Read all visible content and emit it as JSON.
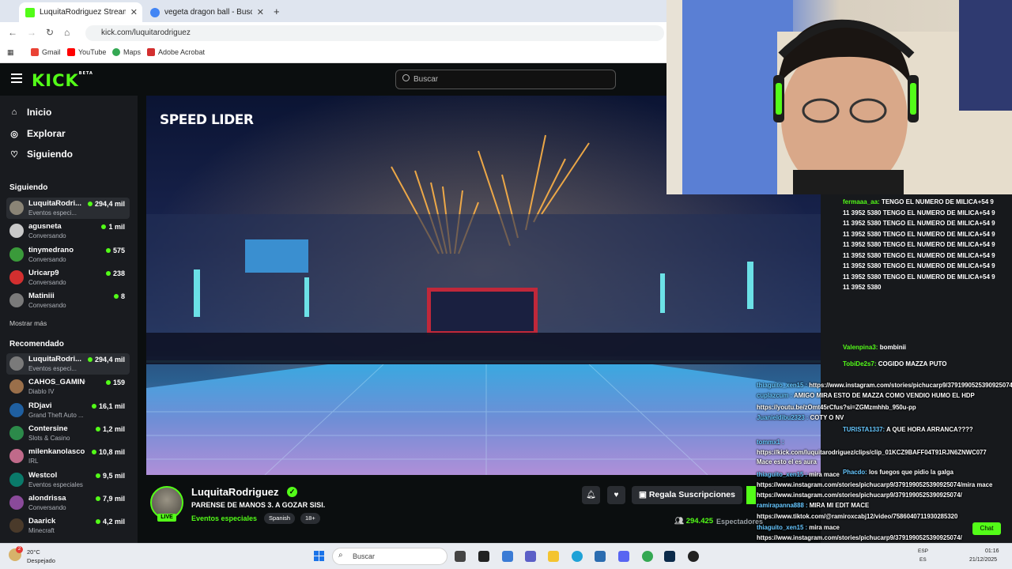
{
  "browser": {
    "tabs": [
      {
        "title": "LuquitaRodriguez Stream"
      },
      {
        "title": "vegeta dragon ball - Buscar con"
      }
    ],
    "url": "kick.com/luquitarodriguez",
    "bookmarks": [
      "Gmail",
      "YouTube",
      "Maps",
      "Adobe Acrobat"
    ]
  },
  "kick": {
    "logo": "KICK",
    "logo_sup": "BETA",
    "search_placeholder": "Buscar"
  },
  "sidebar": {
    "nav": [
      {
        "label": "Inicio",
        "icon": "home-icon"
      },
      {
        "label": "Explorar",
        "icon": "compass-icon"
      },
      {
        "label": "Siguiendo",
        "icon": "heart-icon"
      }
    ],
    "following_header": "Siguiendo",
    "following": [
      {
        "name": "LuquitaRodri...",
        "category": "Eventos especi...",
        "viewers": "294,4 mil"
      },
      {
        "name": "agusneta",
        "category": "Conversando",
        "viewers": "1 mil"
      },
      {
        "name": "tinymedrano",
        "category": "Conversando",
        "viewers": "575"
      },
      {
        "name": "Uricarp9",
        "category": "Conversando",
        "viewers": "238"
      },
      {
        "name": "Matiniii",
        "category": "Conversando",
        "viewers": "8"
      }
    ],
    "show_more": "Mostrar más",
    "recommended_header": "Recomendado",
    "recommended": [
      {
        "name": "LuquitaRodri...",
        "category": "Eventos especi...",
        "viewers": "294,4 mil"
      },
      {
        "name": "CAHOS_GAMING",
        "category": "Diablo IV",
        "viewers": "159"
      },
      {
        "name": "RDjavi",
        "category": "Grand Theft Auto ...",
        "viewers": "16,1 mil"
      },
      {
        "name": "Contersine",
        "category": "Slots & Casino",
        "viewers": "1,2 mil"
      },
      {
        "name": "milenkanolasco",
        "category": "IRL",
        "viewers": "10,8 mil"
      },
      {
        "name": "Westcol",
        "category": "Eventos especiales",
        "viewers": "9,5 mil"
      },
      {
        "name": "alondrissa",
        "category": "Conversando",
        "viewers": "7,9 mil"
      },
      {
        "name": "Daarick",
        "category": "Minecraft",
        "viewers": "4,2 mil"
      }
    ]
  },
  "video": {
    "overlay_logo": "SPEED LIDER"
  },
  "stream": {
    "streamer": "LuquitaRodriguez",
    "live_badge": "LIVE",
    "title": "PARENSE DE MANOS 3. A GOZAR SISI.",
    "category": "Eventos especiales",
    "tags": [
      "Spanish",
      "18+"
    ],
    "gift_label": "Regala Suscripciones",
    "viewers": "294.425",
    "viewers_label": "Espectadores"
  },
  "chat": {
    "messages": [
      {
        "user": "fermaaa_aa:",
        "text": "TENGO EL NUMERO DE MILICA+54 9 11 3952 5380 TENGO EL NUMERO DE MILICA+54 9 11 3952 5380 TENGO EL NUMERO DE MILICA+54 9 11 3952 5380 TENGO EL NUMERO DE MILICA+54 9 11 3952 5380 TENGO EL NUMERO DE MILICA+54 9 11 3952 5380 TENGO EL NUMERO DE MILICA+54 9 11 3952 5380 TENGO EL NUMERO DE MILICA+54 9 11 3952 5380 TENGO EL NUMERO DE MILICA+54 9 11 3952 5380"
      },
      {
        "user": "Valenpina3:",
        "text": "bombinii"
      },
      {
        "user": "TobiDe2s7:",
        "text": "COGIDO MAZZA PUTO"
      }
    ],
    "overlay": [
      {
        "user": "thiaguito_xen15 :",
        "text": "https://www.instagram.com/stories/pichucarp9/3791990525390925074/"
      },
      {
        "user": "cuplazcum :",
        "text": "AMIGO MIRA ESTO DE MAZZA COMO VENDIO HUMO EL HDP"
      },
      {
        "user": "",
        "text": "https://youtu.be/zOmt45rCfus?si=ZGMzmhhb_950u-pp"
      },
      {
        "user": "Juanieldibu2323 :",
        "text": "COTY O NV"
      },
      {
        "user": "TURISTA1337:",
        "text": "A QUE HORA ARRANCA????"
      },
      {
        "user": "tommx1 :",
        "text": ""
      },
      {
        "user": "",
        "text": "https://kick.com/luquitarodriguez/clips/clip_01KCZ9BAFF04T91RJN6ZNWC077"
      },
      {
        "user": "",
        "text": "Mace esto el es aura"
      },
      {
        "user": "Phacdo:",
        "text": "los fuegos que pidio la galga"
      },
      {
        "user": "thiaguito_xen15 :",
        "text": "mira mace"
      },
      {
        "user": "",
        "text": "https://www.instagram.com/stories/pichucarp9/3791990525390925074/mira mace"
      },
      {
        "user": "",
        "text": "https://www.instagram.com/stories/pichucarp9/3791990525390925074/"
      },
      {
        "user": "ramirapanna888 :",
        "text": "MIRA MI EDIT MACE"
      },
      {
        "user": "",
        "text": "https://www.tiktok.com/@ramiroxcabj12/video/7586040711930285320"
      },
      {
        "user": "thiaguito_xen15 :",
        "text": "mira mace"
      },
      {
        "user": "",
        "text": "https://www.instagram.com/stories/pichucarp9/3791990525390925074/"
      },
      {
        "user": "Juanieldibu2323 :",
        "text": "COTY O NV"
      }
    ],
    "chat_button": "Chat"
  },
  "taskbar": {
    "weather_temp": "20°C",
    "weather_desc": "Despejado",
    "weather_badge": "2",
    "search_placeholder": "Buscar",
    "lang_top": "ESP",
    "lang_bottom": "ES",
    "time": "01:16",
    "date": "21/12/2025"
  }
}
